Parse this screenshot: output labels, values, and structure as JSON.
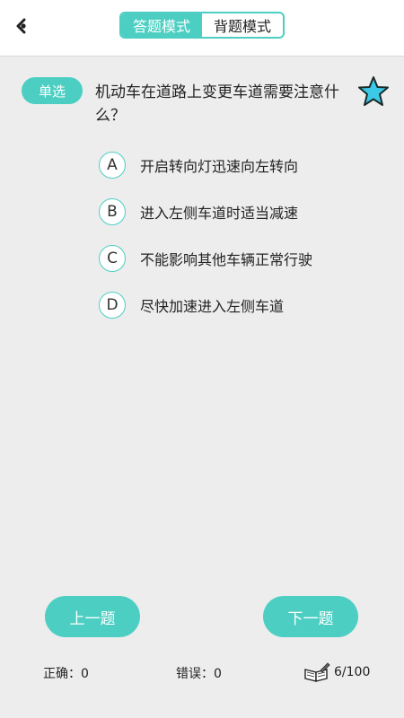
{
  "header": {
    "tabs": [
      {
        "label": "答题模式",
        "active": true
      },
      {
        "label": "背题模式",
        "active": false
      }
    ]
  },
  "question": {
    "type": "单选",
    "text": "机动车在道路上变更车道需要注意什么？",
    "options": [
      {
        "letter": "A",
        "text": "开启转向灯迅速向左转向"
      },
      {
        "letter": "B",
        "text": "进入左侧车道时适当减速"
      },
      {
        "letter": "C",
        "text": "不能影响其他车辆正常行驶"
      },
      {
        "letter": "D",
        "text": "尽快加速进入左侧车道"
      }
    ]
  },
  "nav": {
    "prev_label": "上一题",
    "next_label": "下一题"
  },
  "stats": {
    "correct": "正确：0",
    "wrong": "错误：0",
    "progress": "6/100"
  },
  "colors": {
    "accent": "#4ccfc2",
    "star_fill": "#3cc9e8",
    "background": "#ededed"
  },
  "icons": {
    "back": "back-arrow-icon",
    "favorite": "star-icon",
    "progress": "book-pencil-icon"
  }
}
